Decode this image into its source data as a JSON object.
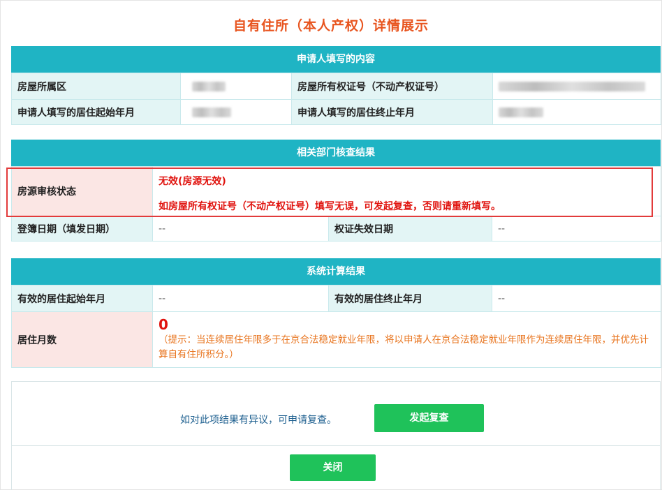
{
  "title": "自有住所（本人产权）详情展示",
  "applicant_section": {
    "header": "申请人填写的内容",
    "district_label": "房屋所属区",
    "certificate_label": "房屋所有权证号（不动产权证号）",
    "start_label": "申请人填写的居住起始年月",
    "end_label": "申请人填写的居住终止年月"
  },
  "review_section": {
    "header": "相关部门核查结果",
    "status_label": "房源审核状态",
    "status_value": "无效(房源无效)",
    "status_note": "如房屋所有权证号（不动产权证号）填写无误，可发起复查，否则请重新填写。",
    "register_date_label": "登簿日期（填发日期）",
    "register_date_value": "--",
    "expire_label": "权证失效日期",
    "expire_value": "--"
  },
  "calc_section": {
    "header": "系统计算结果",
    "valid_start_label": "有效的居住起始年月",
    "valid_start_value": "--",
    "valid_end_label": "有效的居住终止年月",
    "valid_end_value": "--",
    "months_label": "居住月数",
    "months_value": "0",
    "hint": "（提示：当连续居住年限多于在京合法稳定就业年限，将以申请人在京合法稳定就业年限作为连续居住年限，并优先计算自有住所积分。）"
  },
  "footer": {
    "dispute_text": "如对此项结果有异议，可申请复查。",
    "review_button": "发起复查",
    "close_button": "关闭"
  },
  "colors": {
    "accent_header": "#1fb4c4",
    "title": "#e8541e",
    "error": "#e0130e",
    "hint": "#e8741e",
    "button": "#1fc25a",
    "highlight_border": "#e23b3b"
  }
}
